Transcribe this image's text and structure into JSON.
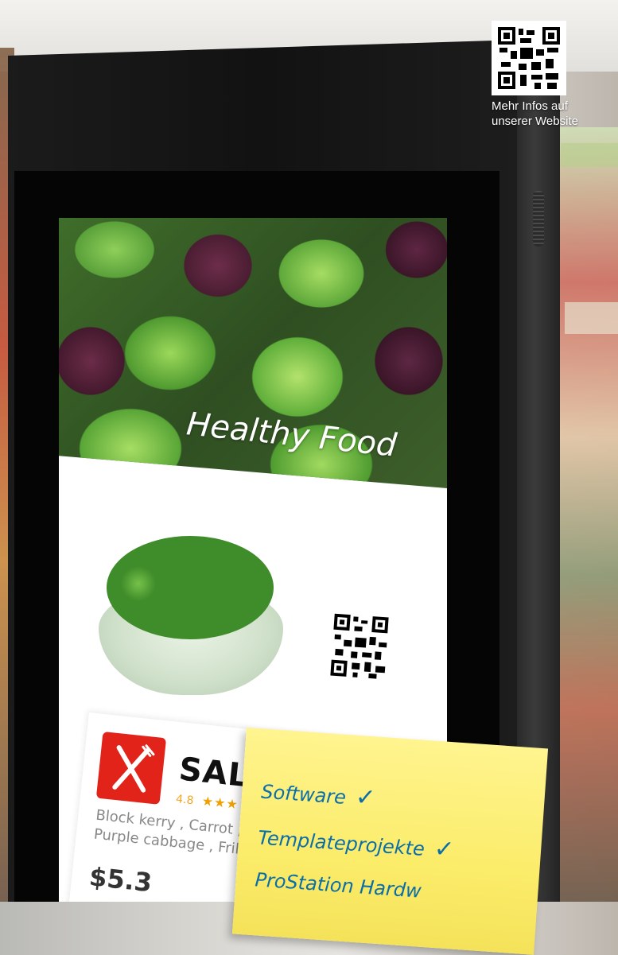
{
  "screen": {
    "headline": "Healthy Food",
    "product": {
      "name": "SALA",
      "rating": "4.8",
      "stars": "★★★",
      "ingredients_line1": "Block kerry , Carrot ,",
      "ingredients_line2": "Purple cabbage , Fril",
      "price": "$5.3"
    }
  },
  "sticky_note": {
    "lines": [
      "Software",
      "Templateprojekte",
      "ProStation Hardw"
    ],
    "check": "✓",
    "ink_color": "#0b6ea8"
  },
  "caption": {
    "line1": "Mehr Infos auf",
    "line2": "unserer Website"
  },
  "colors": {
    "kiosk": "#121212",
    "note": "#fbec6a",
    "app_icon": "#e2231a"
  },
  "icons": [
    "qr-code-icon",
    "fork-knife-icon",
    "star-icon",
    "checkmark-icon"
  ]
}
